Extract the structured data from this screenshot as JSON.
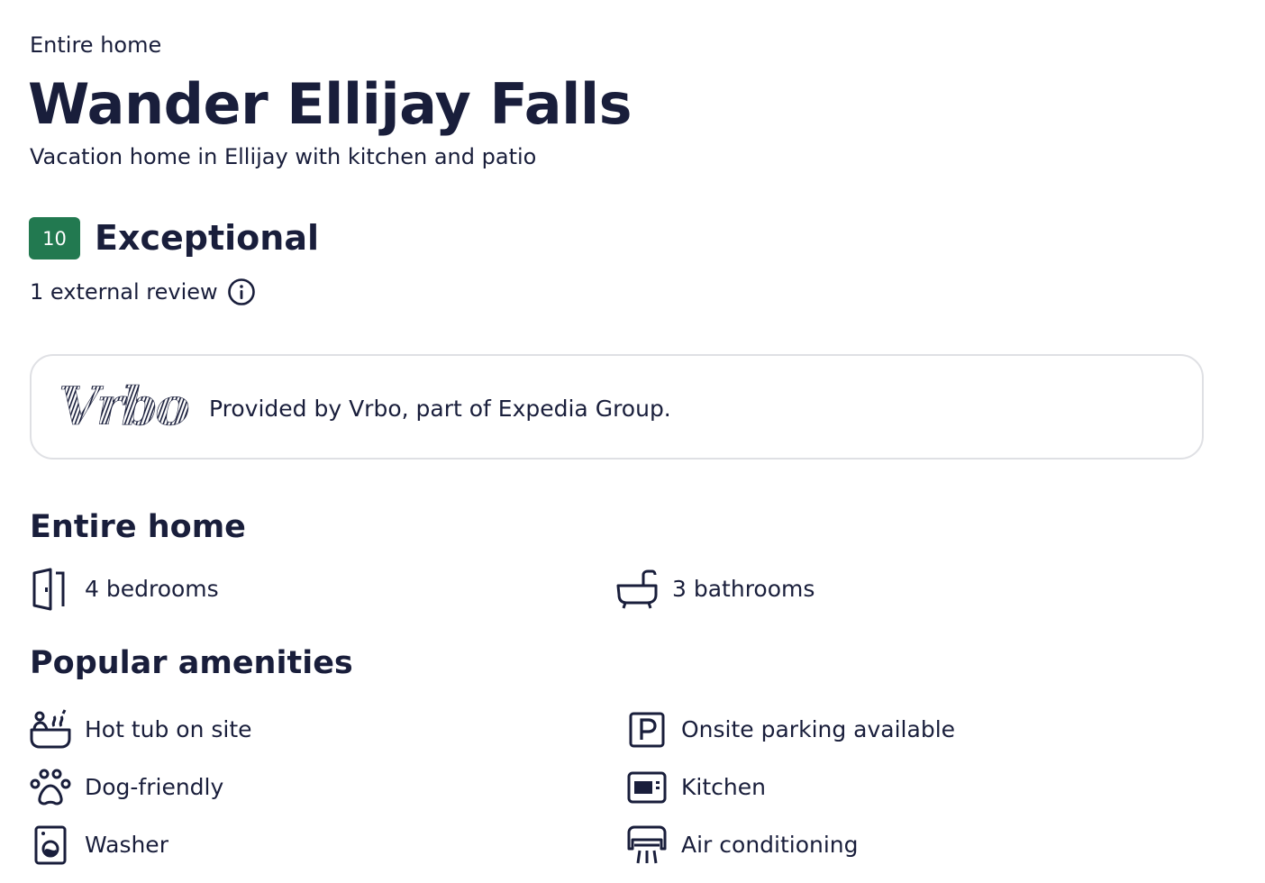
{
  "header": {
    "property_type": "Entire home",
    "title": "Wander Ellijay Falls",
    "subtitle": "Vacation home in Ellijay with kitchen and patio"
  },
  "rating": {
    "score": "10",
    "label": "Exceptional",
    "reviews": "1 external review",
    "badge_color": "#227950"
  },
  "provider": {
    "logo_text": "Vrbo",
    "text": "Provided by Vrbo, part of Expedia Group."
  },
  "rooms": {
    "title": "Entire home",
    "items": [
      {
        "icon": "door-icon",
        "label": "4 bedrooms"
      },
      {
        "icon": "bathtub-icon",
        "label": "3 bathrooms"
      }
    ]
  },
  "amenities": {
    "title": "Popular amenities",
    "items": [
      {
        "icon": "hot-tub-icon",
        "label": "Hot tub on site"
      },
      {
        "icon": "parking-icon",
        "label": "Onsite parking available"
      },
      {
        "icon": "paw-icon",
        "label": "Dog-friendly"
      },
      {
        "icon": "kitchen-icon",
        "label": "Kitchen"
      },
      {
        "icon": "washer-icon",
        "label": "Washer"
      },
      {
        "icon": "air-conditioning-icon",
        "label": "Air conditioning"
      }
    ]
  },
  "colors": {
    "text": "#191e3b",
    "card_border": "#dfe0e4"
  }
}
